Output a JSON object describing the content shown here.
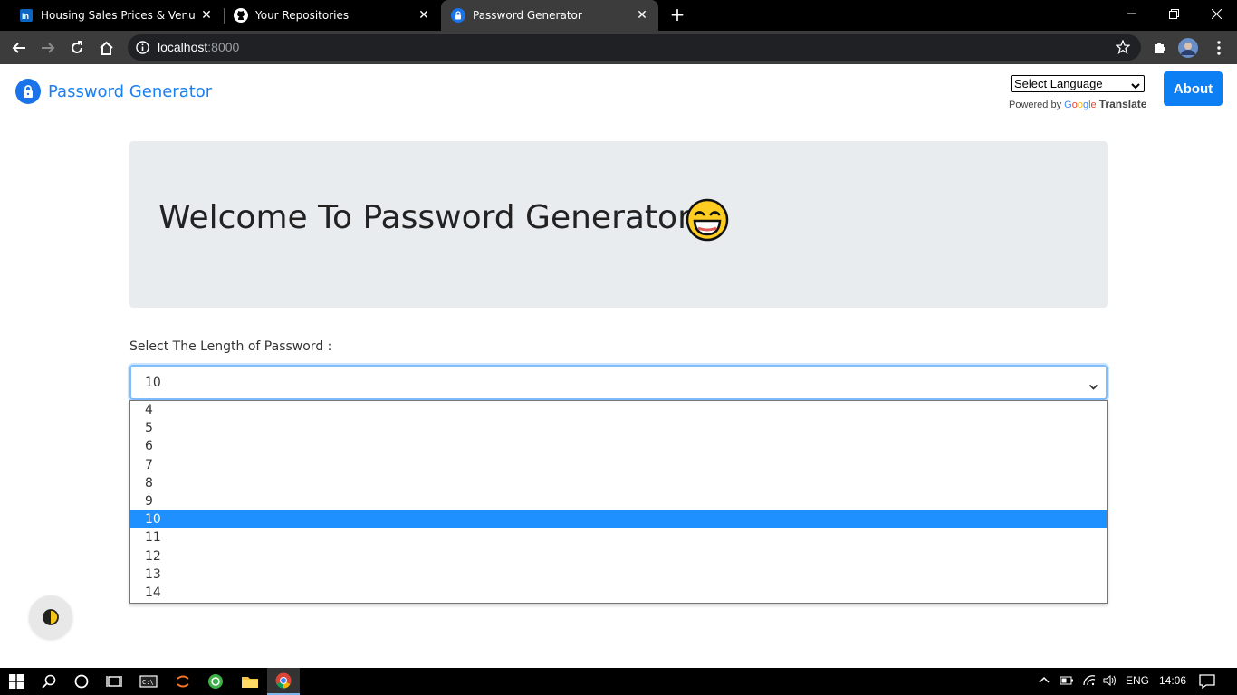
{
  "browser": {
    "tabs": [
      {
        "title": "Housing Sales Prices & Venues D",
        "icon": "linkedin-icon",
        "active": false
      },
      {
        "title": "Your Repositories",
        "icon": "github-icon",
        "active": false
      },
      {
        "title": "Password Generator",
        "icon": "lock-icon",
        "active": true
      }
    ],
    "url_host": "localhost",
    "url_port": ":8000"
  },
  "page": {
    "brand": "Password Generator",
    "language_select": "Select Language",
    "powered_by": "Powered by",
    "google": "Google",
    "translate": "Translate",
    "about_button": "About",
    "heading": "Welcome To Password Generator",
    "length_label": "Select The Length of Password :",
    "length_value": "10",
    "length_options": [
      "4",
      "5",
      "6",
      "7",
      "8",
      "9",
      "10",
      "11",
      "12",
      "13",
      "14"
    ],
    "selected_option": "10"
  },
  "taskbar": {
    "language": "ENG",
    "time": "14:06"
  },
  "colors": {
    "accent": "#0d7ff5",
    "highlight": "#1e90ff",
    "jumbotron": "#e9ecef"
  }
}
